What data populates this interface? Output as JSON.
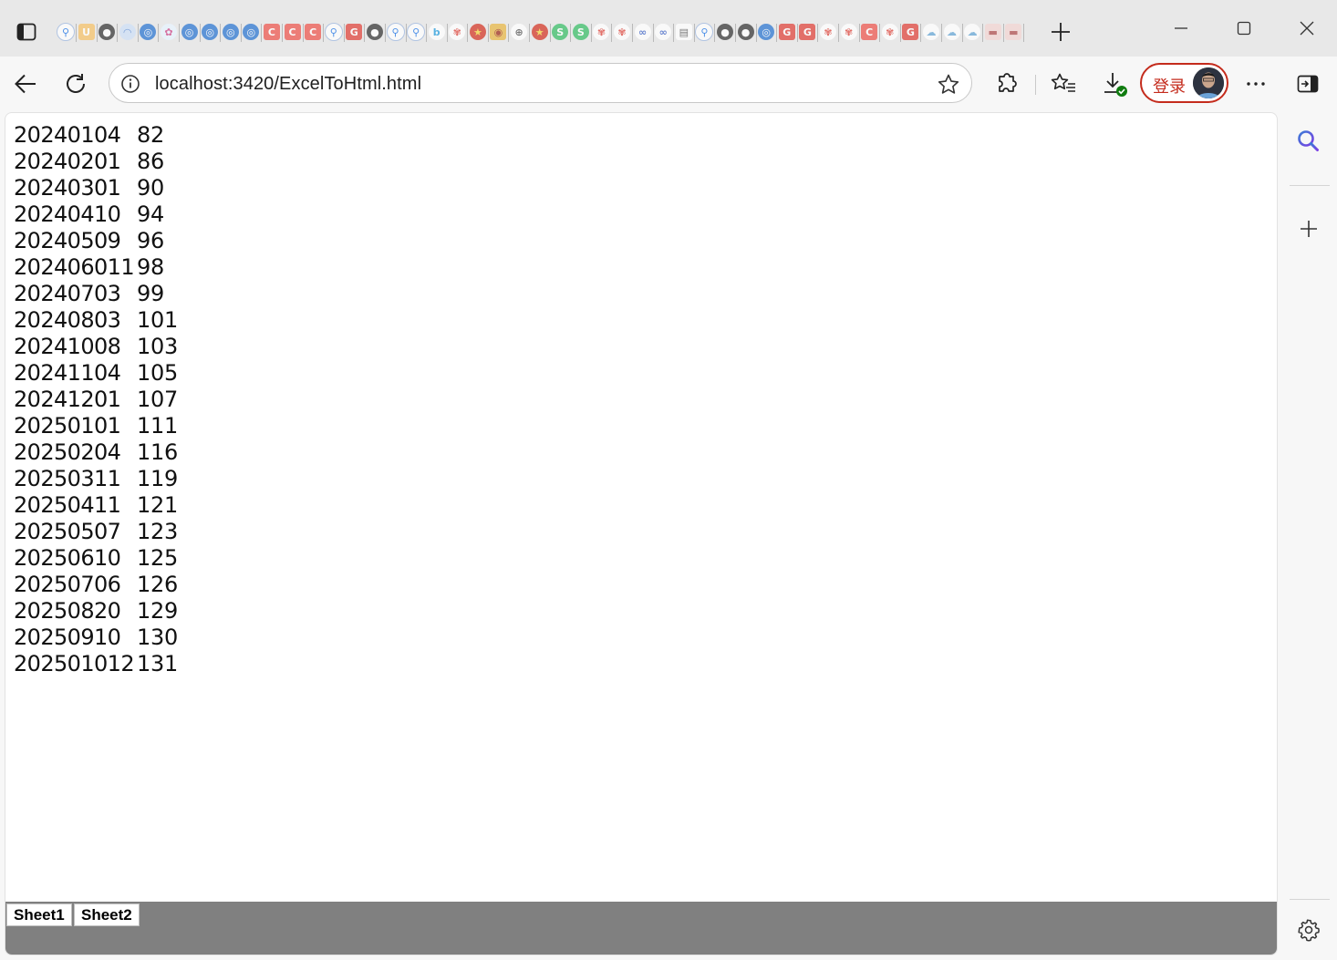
{
  "browser": {
    "tabs": [
      {
        "icon": "search-icon"
      },
      {
        "icon": "u-icon"
      },
      {
        "icon": "github-icon"
      },
      {
        "icon": "rss-icon"
      },
      {
        "icon": "blue-circle-icon"
      },
      {
        "icon": "colorful-icon"
      },
      {
        "icon": "blue-circle-icon"
      },
      {
        "icon": "blue-circle-icon"
      },
      {
        "icon": "blue-circle-icon"
      },
      {
        "icon": "blue-circle-icon"
      },
      {
        "icon": "c-icon"
      },
      {
        "icon": "c-icon"
      },
      {
        "icon": "c-icon"
      },
      {
        "icon": "search-icon"
      },
      {
        "icon": "g-icon"
      },
      {
        "icon": "github-icon"
      },
      {
        "icon": "search-icon"
      },
      {
        "icon": "search-icon"
      },
      {
        "icon": "bing-icon"
      },
      {
        "icon": "huawei-icon"
      },
      {
        "icon": "emblem-icon"
      },
      {
        "icon": "gold-coin-icon"
      },
      {
        "icon": "globe-icon"
      },
      {
        "icon": "emblem-icon"
      },
      {
        "icon": "green-s-icon"
      },
      {
        "icon": "green-s-icon"
      },
      {
        "icon": "huawei-icon"
      },
      {
        "icon": "huawei-icon"
      },
      {
        "icon": "handshake-icon"
      },
      {
        "icon": "handshake-icon"
      },
      {
        "icon": "page-icon"
      },
      {
        "icon": "search-icon"
      },
      {
        "icon": "github-icon"
      },
      {
        "icon": "github-icon"
      },
      {
        "icon": "blue-circle-icon"
      },
      {
        "icon": "g-icon"
      },
      {
        "icon": "g-icon"
      },
      {
        "icon": "huawei-icon"
      },
      {
        "icon": "huawei-icon"
      },
      {
        "icon": "c-icon"
      },
      {
        "icon": "huawei-icon"
      },
      {
        "icon": "g-icon"
      },
      {
        "icon": "cloud-icon"
      },
      {
        "icon": "cloud-icon"
      },
      {
        "icon": "cloud-icon"
      },
      {
        "icon": "banner-icon"
      },
      {
        "icon": "banner-icon"
      }
    ],
    "url": "localhost:3420/ExcelToHtml.html",
    "login_label": "登录"
  },
  "sheet": {
    "rows": [
      [
        "20240104",
        "82"
      ],
      [
        "20240201",
        "86"
      ],
      [
        "20240301",
        "90"
      ],
      [
        "20240410",
        "94"
      ],
      [
        "20240509",
        "96"
      ],
      [
        "202406011",
        "98"
      ],
      [
        "20240703",
        "99"
      ],
      [
        "20240803",
        "101"
      ],
      [
        "20241008",
        "103"
      ],
      [
        "20241104",
        "105"
      ],
      [
        "20241201",
        "107"
      ],
      [
        "20250101",
        "111"
      ],
      [
        "20250204",
        "116"
      ],
      [
        "20250311",
        "119"
      ],
      [
        "20250411",
        "121"
      ],
      [
        "20250507",
        "123"
      ],
      [
        "20250610",
        "125"
      ],
      [
        "20250706",
        "126"
      ],
      [
        "20250820",
        "129"
      ],
      [
        "20250910",
        "130"
      ],
      [
        "202501012",
        "131"
      ]
    ],
    "tabs": [
      "Sheet1",
      "Sheet2"
    ]
  },
  "colors": {
    "accent_red": "#c42b1c",
    "sheet_bar": "#808080"
  }
}
